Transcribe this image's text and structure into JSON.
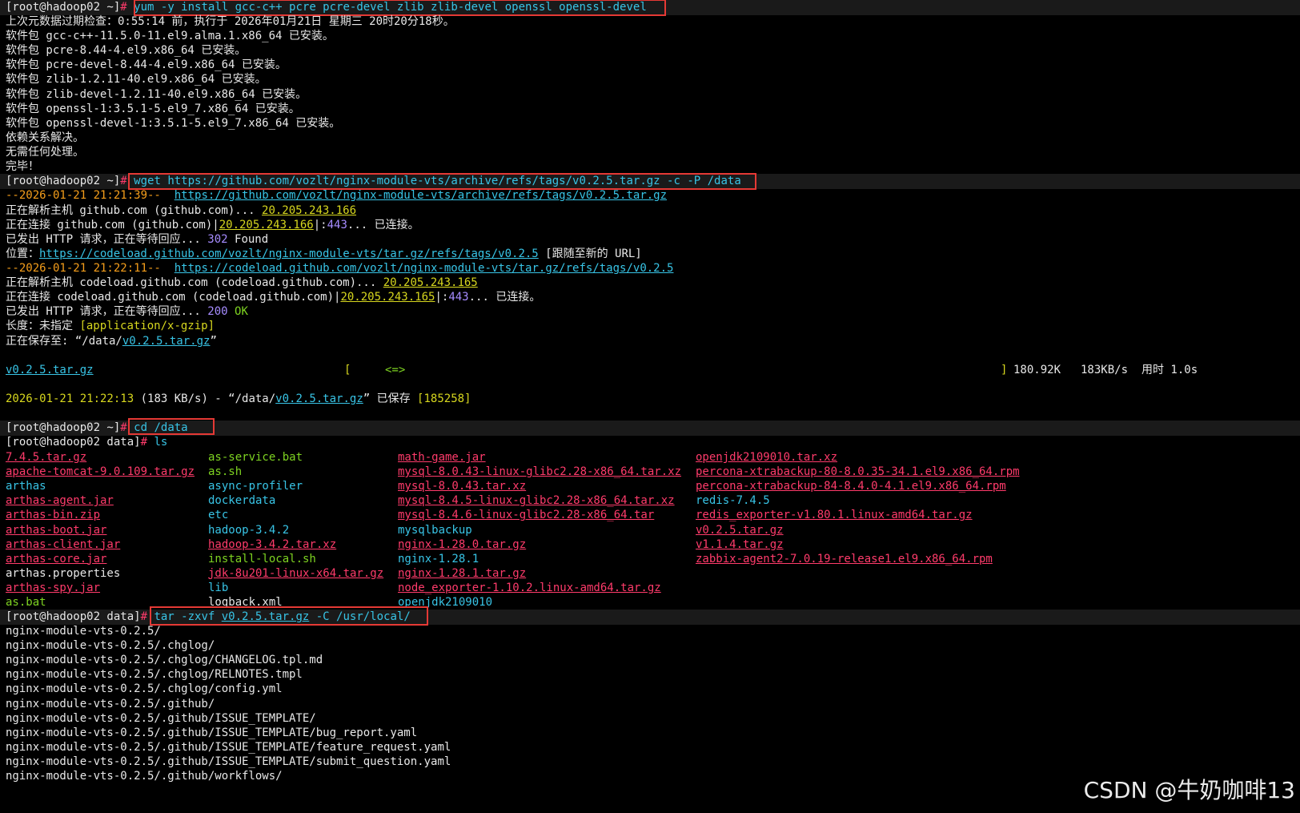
{
  "cmd1": {
    "prompt": "[root@hadoop02 ~]",
    "hash": "#",
    "command": "yum -y install gcc-c++ pcre pcre-devel zlib zlib-devel openssl openssl-devel"
  },
  "yum_output": [
    "上次元数据过期检查：0:55:14 前，执行于 2026年01月21日 星期三 20时20分18秒。",
    "软件包 gcc-c++-11.5.0-11.el9.alma.1.x86_64 已安装。",
    "软件包 pcre-8.44-4.el9.x86_64 已安装。",
    "软件包 pcre-devel-8.44-4.el9.x86_64 已安装。",
    "软件包 zlib-1.2.11-40.el9.x86_64 已安装。",
    "软件包 zlib-devel-1.2.11-40.el9.x86_64 已安装。",
    "软件包 openssl-1:3.5.1-5.el9_7.x86_64 已安装。",
    "软件包 openssl-devel-1:3.5.1-5.el9_7.x86_64 已安装。",
    "依赖关系解决。",
    "无需任何处理。",
    "完毕！"
  ],
  "cmd2": {
    "prompt": "[root@hadoop02 ~]",
    "hash": "#",
    "command": "wget https://github.com/vozlt/nginx-module-vts/archive/refs/tags/v0.2.5.tar.gz -c -P /data"
  },
  "wget_output": {
    "l1_time": "--2026-01-21 21:21:39--",
    "l1_url": "https://github.com/vozlt/nginx-module-vts/archive/refs/tags/v0.2.5.tar.gz",
    "l2_text": "正在解析主机 github.com (github.com)... ",
    "l2_ip": "20.205.243.166",
    "l3_a": "正在连接 github.com (github.com)|",
    "l3_ip": "20.205.243.166",
    "l3_b": "|:",
    "l3_port": "443",
    "l3_c": "... 已连接。",
    "l4_a": "已发出 HTTP 请求，正在等待回应... ",
    "l4_code": "302",
    "l4_b": " Found",
    "l5_a": "位置：",
    "l5_url": "https://codeload.github.com/vozlt/nginx-module-vts/tar.gz/refs/tags/v0.2.5",
    "l5_b": " [跟随至新的 URL]",
    "l6_time": "--2026-01-21 21:22:11--",
    "l6_url": "https://codeload.github.com/vozlt/nginx-module-vts/tar.gz/refs/tags/v0.2.5",
    "l7_text": "正在解析主机 codeload.github.com (codeload.github.com)... ",
    "l7_ip": "20.205.243.165",
    "l8_a": "正在连接 codeload.github.com (codeload.github.com)|",
    "l8_ip": "20.205.243.165",
    "l8_b": "|:",
    "l8_port": "443",
    "l8_c": "... 已连接。",
    "l9_a": "已发出 HTTP 请求，正在等待回应... ",
    "l9_code": "200",
    "l9_b": " OK",
    "l10_a": "长度：未指定 ",
    "l10_b": "[application/x-gzip]",
    "l11_a": "正在保存至: “/data/",
    "l11_file": "v0.2.5.tar.gz",
    "l11_b": "”",
    "progress_file": "v0.2.5.tar.gz",
    "progress_open": "[",
    "progress_arrow": "<=>",
    "progress_close": "]",
    "progress_size": "180.92K",
    "progress_speed": "183KB/s",
    "progress_time": "用时 1.0s",
    "saved_time": "2026-01-21 21:22:13",
    "saved_rate": " (183 KB/s) - “/data/",
    "saved_file": "v0.2.5.tar.gz",
    "saved_b": "” 已保存 ",
    "saved_bytes": "[185258]"
  },
  "cmd3": {
    "prompt": "[root@hadoop02 ~]",
    "hash": "#",
    "command": "cd /data"
  },
  "cmd4": {
    "prompt": "[root@hadoop02 data]",
    "hash": "#",
    "command": "ls"
  },
  "ls_columns": [
    [
      {
        "t": "7.4.5.tar.gz",
        "k": "r"
      },
      {
        "t": "apache-tomcat-9.0.109.tar.gz",
        "k": "r"
      },
      {
        "t": "arthas",
        "k": "c"
      },
      {
        "t": "arthas-agent.jar",
        "k": "r"
      },
      {
        "t": "arthas-bin.zip",
        "k": "r"
      },
      {
        "t": "arthas-boot.jar",
        "k": "r"
      },
      {
        "t": "arthas-client.jar",
        "k": "r"
      },
      {
        "t": "arthas-core.jar",
        "k": "r"
      },
      {
        "t": "arthas.properties",
        "k": "w"
      },
      {
        "t": "arthas-spy.jar",
        "k": "r"
      },
      {
        "t": "as.bat",
        "k": "g"
      }
    ],
    [
      {
        "t": "as-service.bat",
        "k": "g"
      },
      {
        "t": "as.sh",
        "k": "g"
      },
      {
        "t": "async-profiler",
        "k": "c"
      },
      {
        "t": "dockerdata",
        "k": "c"
      },
      {
        "t": "etc",
        "k": "c"
      },
      {
        "t": "hadoop-3.4.2",
        "k": "c"
      },
      {
        "t": "hadoop-3.4.2.tar.xz",
        "k": "r"
      },
      {
        "t": "install-local.sh",
        "k": "g"
      },
      {
        "t": "jdk-8u201-linux-x64.tar.gz",
        "k": "r"
      },
      {
        "t": "lib",
        "k": "c"
      },
      {
        "t": "logback.xml",
        "k": "w"
      }
    ],
    [
      {
        "t": "math-game.jar",
        "k": "r"
      },
      {
        "t": "mysql-8.0.43-linux-glibc2.28-x86_64.tar.xz",
        "k": "r"
      },
      {
        "t": "mysql-8.0.43.tar.xz",
        "k": "r"
      },
      {
        "t": "mysql-8.4.5-linux-glibc2.28-x86_64.tar.xz",
        "k": "r"
      },
      {
        "t": "mysql-8.4.6-linux-glibc2.28-x86_64.tar",
        "k": "r"
      },
      {
        "t": "mysqlbackup",
        "k": "c"
      },
      {
        "t": "nginx-1.28.0.tar.gz",
        "k": "r"
      },
      {
        "t": "nginx-1.28.1",
        "k": "c"
      },
      {
        "t": "nginx-1.28.1.tar.gz",
        "k": "r"
      },
      {
        "t": "node_exporter-1.10.2.linux-amd64.tar.gz",
        "k": "r"
      },
      {
        "t": "openjdk2109010",
        "k": "c"
      }
    ],
    [
      {
        "t": "openjdk2109010.tar.xz",
        "k": "r"
      },
      {
        "t": "percona-xtrabackup-80-8.0.35-34.1.el9.x86_64.rpm",
        "k": "r"
      },
      {
        "t": "percona-xtrabackup-84-8.4.0-4.1.el9.x86_64.rpm",
        "k": "r"
      },
      {
        "t": "redis-7.4.5",
        "k": "c"
      },
      {
        "t": "redis_exporter-v1.80.1.linux-amd64.tar.gz",
        "k": "r"
      },
      {
        "t": "v0.2.5.tar.gz",
        "k": "r"
      },
      {
        "t": "v1.1.4.tar.gz",
        "k": "r"
      },
      {
        "t": "zabbix-agent2-7.0.19-release1.el9.x86_64.rpm",
        "k": "r"
      }
    ]
  ],
  "cmd5": {
    "prompt": "[root@hadoop02 data]",
    "hash": "#",
    "cmd_a": "tar -zxvf ",
    "cmd_file": "v0.2.5.tar.gz",
    "cmd_b": " -C /usr/local/"
  },
  "tar_output": [
    "nginx-module-vts-0.2.5/",
    "nginx-module-vts-0.2.5/.chglog/",
    "nginx-module-vts-0.2.5/.chglog/CHANGELOG.tpl.md",
    "nginx-module-vts-0.2.5/.chglog/RELNOTES.tmpl",
    "nginx-module-vts-0.2.5/.chglog/config.yml",
    "nginx-module-vts-0.2.5/.github/",
    "nginx-module-vts-0.2.5/.github/ISSUE_TEMPLATE/",
    "nginx-module-vts-0.2.5/.github/ISSUE_TEMPLATE/bug_report.yaml",
    "nginx-module-vts-0.2.5/.github/ISSUE_TEMPLATE/feature_request.yaml",
    "nginx-module-vts-0.2.5/.github/ISSUE_TEMPLATE/submit_question.yaml",
    "nginx-module-vts-0.2.5/.github/workflows/"
  ],
  "watermark": "CSDN @牛奶咖啡13",
  "colors": {
    "highlight_box": "#e53935",
    "background": "#000000",
    "link": "#38c4e6",
    "archive": "#ff3b6b",
    "directory": "#38c4e6",
    "executable": "#7ed321"
  }
}
